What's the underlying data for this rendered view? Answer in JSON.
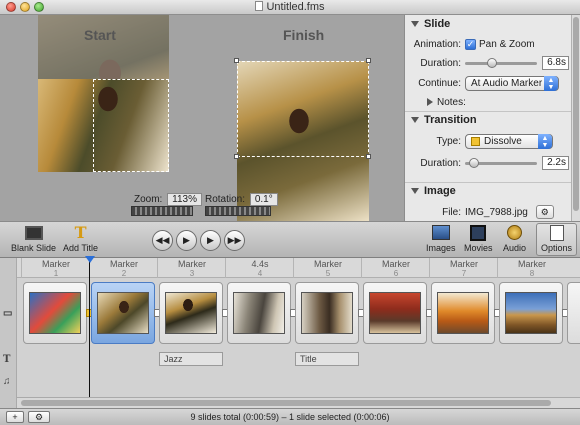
{
  "window": {
    "title": "Untitled.fms"
  },
  "preview": {
    "start_label": "Start",
    "finish_label": "Finish",
    "zoom_label": "Zoom:",
    "zoom_value": "113%",
    "rotation_label": "Rotation:",
    "rotation_value": "0.1°"
  },
  "inspector": {
    "slide": {
      "heading": "Slide",
      "animation_label": "Animation:",
      "animation_value": "Pan & Zoom",
      "animation_checked": true,
      "duration_label": "Duration:",
      "duration_value": "6.8s",
      "continue_label": "Continue:",
      "continue_value": "At Audio Marker",
      "notes_label": "Notes:"
    },
    "transition": {
      "heading": "Transition",
      "type_label": "Type:",
      "type_value": "Dissolve",
      "duration_label": "Duration:",
      "duration_value": "2.2s"
    },
    "image": {
      "heading": "Image",
      "file_label": "File:",
      "file_value": "IMG_7988.jpg"
    }
  },
  "toolbar": {
    "blank_slide": "Blank Slide",
    "add_title": "Add Title",
    "images": "Images",
    "movies": "Movies",
    "audio": "Audio",
    "options": "Options",
    "transport": [
      "◀◀",
      "▶",
      "▶",
      "▶▶"
    ]
  },
  "timeline": {
    "ruler": [
      {
        "label": "Marker",
        "num": "1"
      },
      {
        "label": "Marker",
        "num": "2"
      },
      {
        "label": "Marker",
        "num": "3"
      },
      {
        "label": "4.4s",
        "num": "4"
      },
      {
        "label": "Marker",
        "num": "5"
      },
      {
        "label": "Marker",
        "num": "6"
      },
      {
        "label": "Marker",
        "num": "7"
      },
      {
        "label": "Marker",
        "num": "8"
      }
    ],
    "slides": [
      {
        "name": "slide-1",
        "selected": false
      },
      {
        "name": "slide-2",
        "selected": true
      },
      {
        "name": "slide-3",
        "selected": false
      },
      {
        "name": "slide-4",
        "selected": false
      },
      {
        "name": "slide-5",
        "selected": false
      },
      {
        "name": "slide-6",
        "selected": false
      },
      {
        "name": "slide-7",
        "selected": false
      },
      {
        "name": "slide-8",
        "selected": false
      }
    ],
    "title_chips": [
      "Jazz",
      "Title"
    ]
  },
  "status": {
    "text": "9 slides total (0:00:59)  –  1 slide selected (0:00:06)",
    "add_button": "+",
    "gear_button": "⚙"
  },
  "colors": {
    "accent": "#2d6fd6",
    "selection": "#7aa6e0",
    "transition_icon": "#f1c232"
  }
}
